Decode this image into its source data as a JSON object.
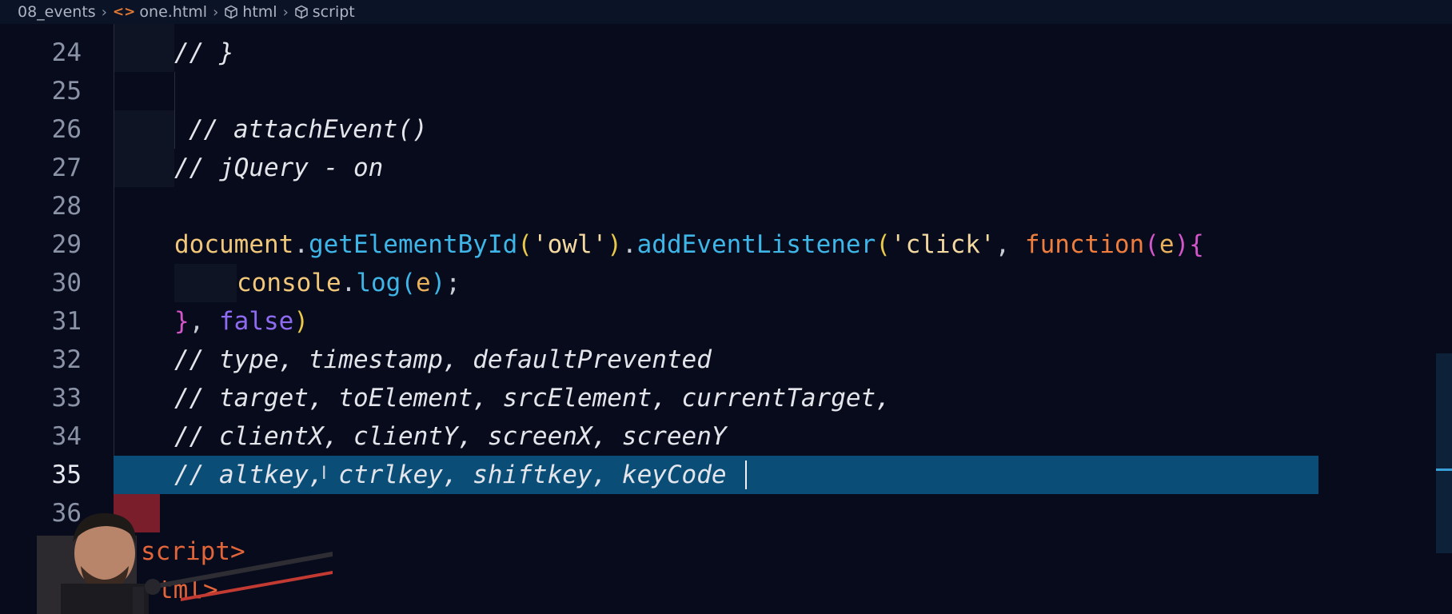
{
  "breadcrumb": {
    "folder": "08_events",
    "file": "one.html",
    "html": "html",
    "script": "script"
  },
  "editor": {
    "active_line": "35",
    "lines": [
      {
        "num": "24",
        "text": "// }"
      },
      {
        "num": "25",
        "text": ""
      },
      {
        "num": "26",
        "text": "// attachEvent()"
      },
      {
        "num": "27",
        "text": "// jQuery - on"
      },
      {
        "num": "28",
        "text": ""
      },
      {
        "num": "29",
        "text": "document.getElementById('owl').addEventListener('click', function(e){"
      },
      {
        "num": "30",
        "text": "console.log(e);"
      },
      {
        "num": "31",
        "text": "}, false)"
      },
      {
        "num": "32",
        "text": "// type, timestamp, defaultPrevented"
      },
      {
        "num": "33",
        "text": "// target, toElement, srcElement, currentTarget,"
      },
      {
        "num": "34",
        "text": "// clientX, clientY, screenX, screenY"
      },
      {
        "num": "35",
        "text": "// altkey, ctrlkey, shiftkey, keyCode"
      },
      {
        "num": "36",
        "text": ""
      }
    ],
    "tokens": {
      "document": "document",
      "dot1": ".",
      "getElementById": "getElementById",
      "paren_open1": "(",
      "str_owl": "'owl'",
      "paren_close1": ")",
      "dot2": ".",
      "addEventListener": "addEventListener",
      "paren_open2": "(",
      "str_click": "'click'",
      "comma": ", ",
      "function_kw": "function",
      "paren_open3": "(",
      "param_e": "e",
      "paren_close3": ")",
      "brace_open": "{",
      "console": "console",
      "dot3": ".",
      "log": "log",
      "paren_open4": "(",
      "arg_e": "e",
      "paren_close4": ")",
      "semicolon": ";",
      "brace_close": "}",
      "comma2": ", ",
      "false_kw": "false",
      "paren_close5": ")"
    },
    "tags": {
      "script_close": "script>",
      "html_close": "tml>"
    }
  },
  "colors": {
    "background": "#070b1c",
    "line_highlight": "#0a4e78",
    "function_name": "#3fb6e8",
    "keyword": "#ef7d3d",
    "boolean": "#8e6bf0"
  }
}
